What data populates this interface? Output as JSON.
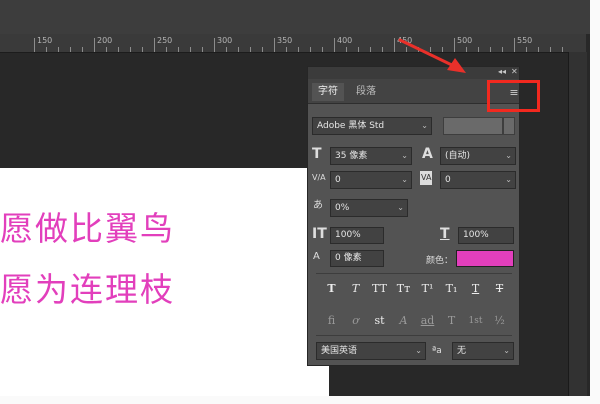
{
  "ruler": {
    "labels": [
      "150",
      "200",
      "250",
      "300",
      "350",
      "400",
      "450",
      "500",
      "550"
    ]
  },
  "canvas": {
    "lines": [
      "愿做比翼鸟",
      "愿为连理枝"
    ]
  },
  "panel": {
    "tabs": [
      {
        "label": "字符",
        "active": true
      },
      {
        "label": "段落",
        "active": false
      }
    ],
    "head_glyphs": {
      "collapse": "◂◂",
      "close": "✕"
    },
    "menu_icon": "≡",
    "font_family": "Adobe 黑体 Std",
    "font_size": "35 像素",
    "leading": "(自动)",
    "kerning": "0",
    "tracking": "0",
    "tsume": "0%",
    "vertical_scale": "100%",
    "horizontal_scale": "100%",
    "baseline_shift": "0 像素",
    "color_label": "颜色：",
    "color_value": "#e23fbc",
    "language": "美国英语",
    "antialias_icon_text": "ªa",
    "antialias": "无",
    "style_buttons": [
      "T",
      "T",
      "TT",
      "Tт",
      "T¹",
      "T₁",
      "T",
      "T"
    ],
    "opentype_buttons": [
      "fi",
      "ơ",
      "st",
      "A",
      "ad",
      "T",
      "1st",
      "½"
    ]
  },
  "icons": {
    "font-size": "T",
    "leading": "A",
    "kerning": "V/A",
    "tracking": "VA",
    "tsume": "あ",
    "vertical-scale": "IT",
    "horizontal-scale": "T",
    "baseline": "A"
  },
  "colors": {
    "text_pink": "#e23fbc",
    "highlight_red": "#f2291f",
    "arrow_red": "#e9302a"
  }
}
